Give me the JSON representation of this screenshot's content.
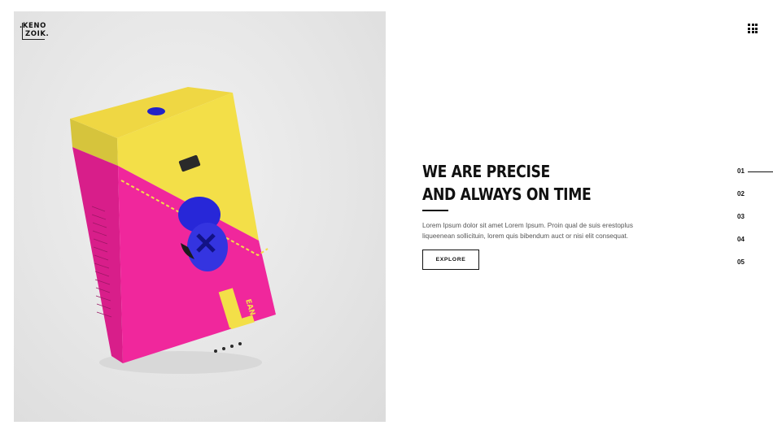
{
  "brand": {
    "logo_line1": ".KENO",
    "logo_line2": "ZOIK."
  },
  "header": {
    "menu_icon": "grid-menu-icon"
  },
  "hero": {
    "headline_line1": "WE ARE PRECISE",
    "headline_line2": "AND ALWAYS ON TIME",
    "description": "Lorem Ipsum dolor sit amet Lorem Ipsum. Proin qual de suis erestoplus liqueenean sollicituin, lorem quis bibendum auct or nisi elit consequat.",
    "cta_label": "EXPLORE"
  },
  "product_image": {
    "box_brand": "LEAN",
    "box_colors": {
      "yellow": "#f3df48",
      "pink": "#f0279c",
      "blue": "#2626d6"
    }
  },
  "slide_nav": {
    "items": [
      "01",
      "02",
      "03",
      "04",
      "05"
    ],
    "active_index": 0
  }
}
